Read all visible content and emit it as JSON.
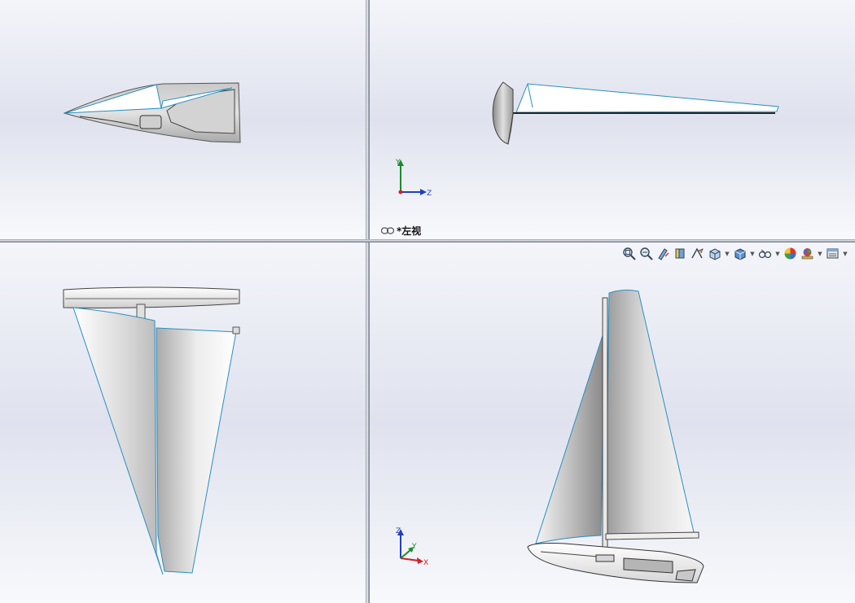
{
  "viewports": {
    "top_right": {
      "view_label": "*左视",
      "triad": {
        "x": "",
        "y": "Y",
        "z": "Z"
      }
    },
    "bottom_right": {
      "triad": {
        "x": "X",
        "y": "Y",
        "z": "Z"
      },
      "toolbar": [
        {
          "icon": "zoom-to-fit-icon"
        },
        {
          "icon": "zoom-to-area-icon"
        },
        {
          "icon": "previous-view-icon"
        },
        {
          "icon": "section-view-icon"
        },
        {
          "icon": "dynamic-annotation-icon"
        },
        {
          "icon": "view-orientation-icon",
          "dropdown": true
        },
        {
          "icon": "display-style-icon",
          "dropdown": true
        },
        {
          "icon": "hide-show-items-icon",
          "dropdown": true
        },
        {
          "icon": "edit-appearance-icon"
        },
        {
          "icon": "apply-scene-icon",
          "dropdown": true
        },
        {
          "icon": "view-settings-icon",
          "dropdown": true
        }
      ]
    }
  },
  "colors": {
    "edge_blue": "#2a8fc0",
    "triad_x": "#d0202a",
    "triad_y": "#1c8a2a",
    "triad_z": "#1f3fc0"
  }
}
